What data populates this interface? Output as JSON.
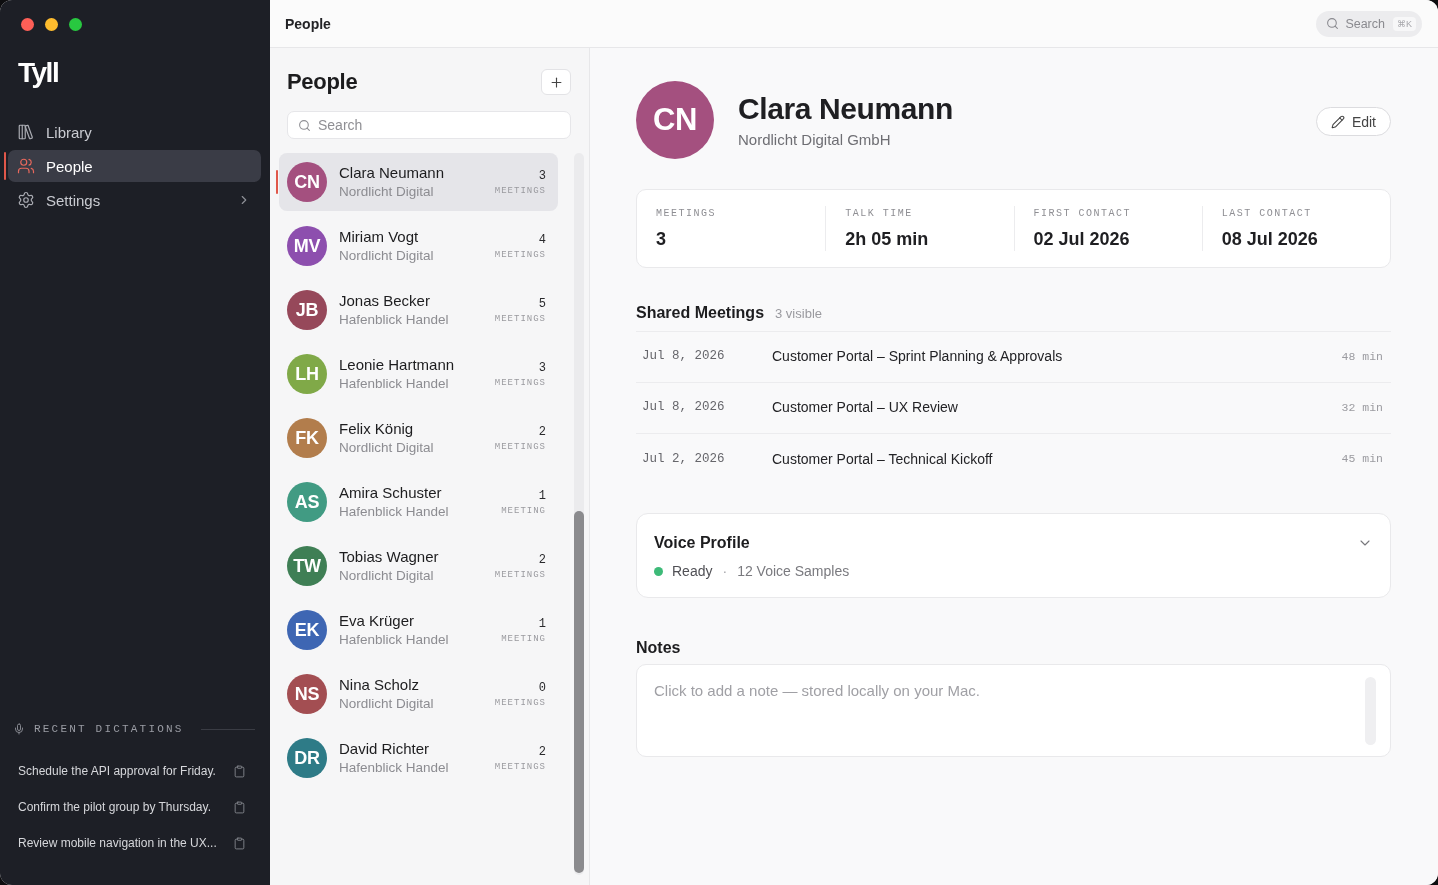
{
  "sidebar": {
    "logo": "Tyll",
    "nav": [
      {
        "label": "Library",
        "kind": "link",
        "selected": false
      },
      {
        "label": "People",
        "kind": "link",
        "selected": true
      },
      {
        "label": "Settings",
        "kind": "group",
        "selected": false
      }
    ],
    "recent_dictations": {
      "title": "RECENT DICTATIONS",
      "items": [
        "Schedule the API approval for Friday.",
        "Confirm the pilot group by Thursday.",
        "Review mobile navigation in the UX..."
      ]
    }
  },
  "top_bar": {
    "title": "People",
    "search": {
      "label": "Search",
      "shortcut": "⌘K"
    }
  },
  "people_panel": {
    "title": "People",
    "search": {
      "placeholder": "Search"
    },
    "people": [
      {
        "initials": "CN",
        "name": "Clara Neumann",
        "company": "Nordlicht Digital",
        "count": "3",
        "count_label": "MEETINGS",
        "color": "#a4507f",
        "selected": true
      },
      {
        "initials": "MV",
        "name": "Miriam Vogt",
        "company": "Nordlicht Digital",
        "count": "4",
        "count_label": "MEETINGS",
        "color": "#8d4fae",
        "selected": false
      },
      {
        "initials": "JB",
        "name": "Jonas Becker",
        "company": "Hafenblick Handel",
        "count": "5",
        "count_label": "MEETINGS",
        "color": "#96485a",
        "selected": false
      },
      {
        "initials": "LH",
        "name": "Leonie Hartmann",
        "company": "Hafenblick Handel",
        "count": "3",
        "count_label": "MEETINGS",
        "color": "#80a948",
        "selected": false
      },
      {
        "initials": "FK",
        "name": "Felix König",
        "company": "Nordlicht Digital",
        "count": "2",
        "count_label": "MEETINGS",
        "color": "#b27d4c",
        "selected": false
      },
      {
        "initials": "AS",
        "name": "Amira Schuster",
        "company": "Hafenblick Handel",
        "count": "1",
        "count_label": "MEETING",
        "color": "#419b83",
        "selected": false
      },
      {
        "initials": "TW",
        "name": "Tobias Wagner",
        "company": "Nordlicht Digital",
        "count": "2",
        "count_label": "MEETINGS",
        "color": "#3f7f55",
        "selected": false
      },
      {
        "initials": "EK",
        "name": "Eva Krüger",
        "company": "Hafenblick Handel",
        "count": "1",
        "count_label": "MEETING",
        "color": "#3e66b3",
        "selected": false
      },
      {
        "initials": "NS",
        "name": "Nina Scholz",
        "company": "Nordlicht Digital",
        "count": "0",
        "count_label": "MEETINGS",
        "color": "#a34e52",
        "selected": false
      },
      {
        "initials": "DR",
        "name": "David Richter",
        "company": "Hafenblick Handel",
        "count": "2",
        "count_label": "MEETINGS",
        "color": "#2e7b87",
        "selected": false
      }
    ]
  },
  "detail": {
    "initials": "CN",
    "name": "Clara Neumann",
    "company": "Nordlicht Digital GmbH",
    "edit_button": "Edit",
    "stats": [
      {
        "label": "MEETINGS",
        "value": "3"
      },
      {
        "label": "TALK TIME",
        "value": "2h 05 min"
      },
      {
        "label": "FIRST CONTACT",
        "value": "02 Jul 2026"
      },
      {
        "label": "LAST CONTACT",
        "value": "08 Jul 2026"
      }
    ],
    "shared_meetings": {
      "title": "Shared Meetings",
      "count": "3 visible",
      "rows": [
        {
          "date": "Jul 8, 2026",
          "title": "Customer Portal – Sprint Planning & Approvals",
          "duration": "48 min"
        },
        {
          "date": "Jul 8, 2026",
          "title": "Customer Portal – UX Review",
          "duration": "32 min"
        },
        {
          "date": "Jul 2, 2026",
          "title": "Customer Portal – Technical Kickoff",
          "duration": "45 min"
        }
      ]
    },
    "voice_profile": {
      "title": "Voice Profile",
      "expanded": false,
      "status": {
        "kind": "ready",
        "label": "Ready"
      },
      "separator": "·",
      "samples": "12 Voice Samples"
    },
    "notes": {
      "title": "Notes",
      "placeholder": "Click to add a note — stored locally on your Mac."
    }
  }
}
